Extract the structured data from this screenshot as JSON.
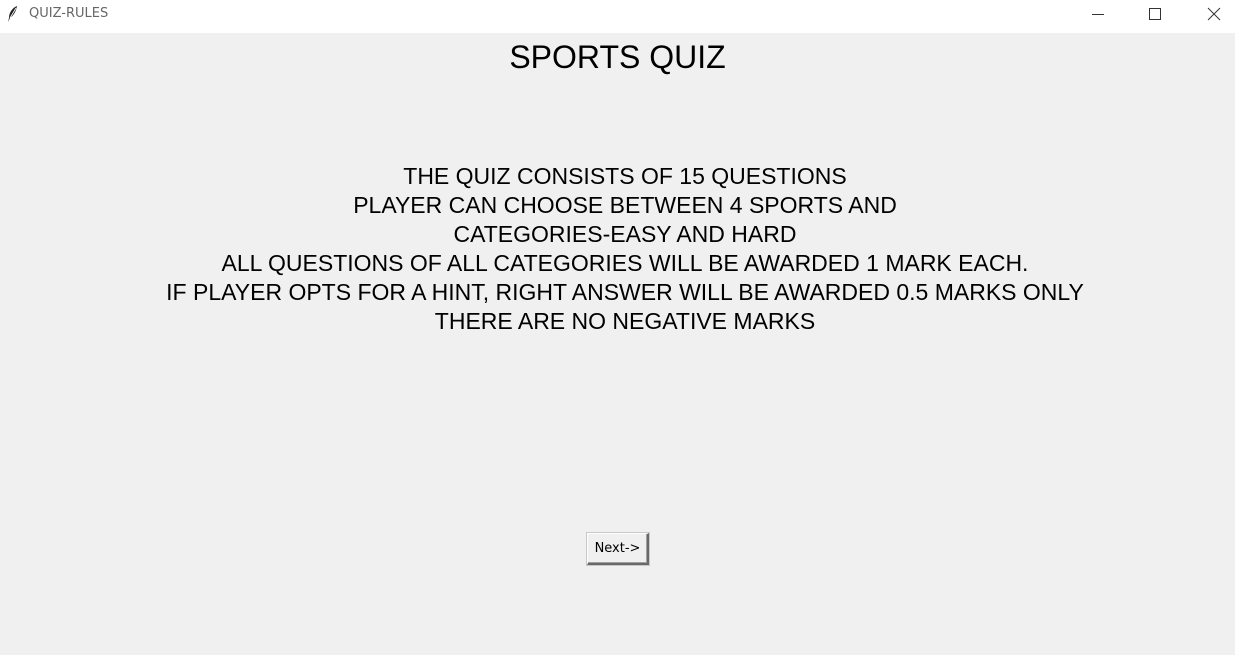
{
  "window": {
    "title": "QUIZ-RULES",
    "app_icon": "feather-icon"
  },
  "quiz": {
    "title": "SPORTS QUIZ",
    "rules": [
      "THE QUIZ CONSISTS OF 15 QUESTIONS",
      "PLAYER CAN CHOOSE BETWEEN 4 SPORTS AND",
      "CATEGORIES-EASY AND HARD",
      "ALL QUESTIONS OF ALL CATEGORIES WILL BE AWARDED 1 MARK EACH.",
      "IF PLAYER OPTS FOR A HINT, RIGHT ANSWER WILL BE AWARDED 0.5 MARKS ONLY",
      "THERE ARE NO NEGATIVE MARKS"
    ],
    "next_label": "Next->"
  },
  "colors": {
    "background": "#f0f0f0",
    "titlebar": "#ffffff",
    "text": "#000000"
  }
}
